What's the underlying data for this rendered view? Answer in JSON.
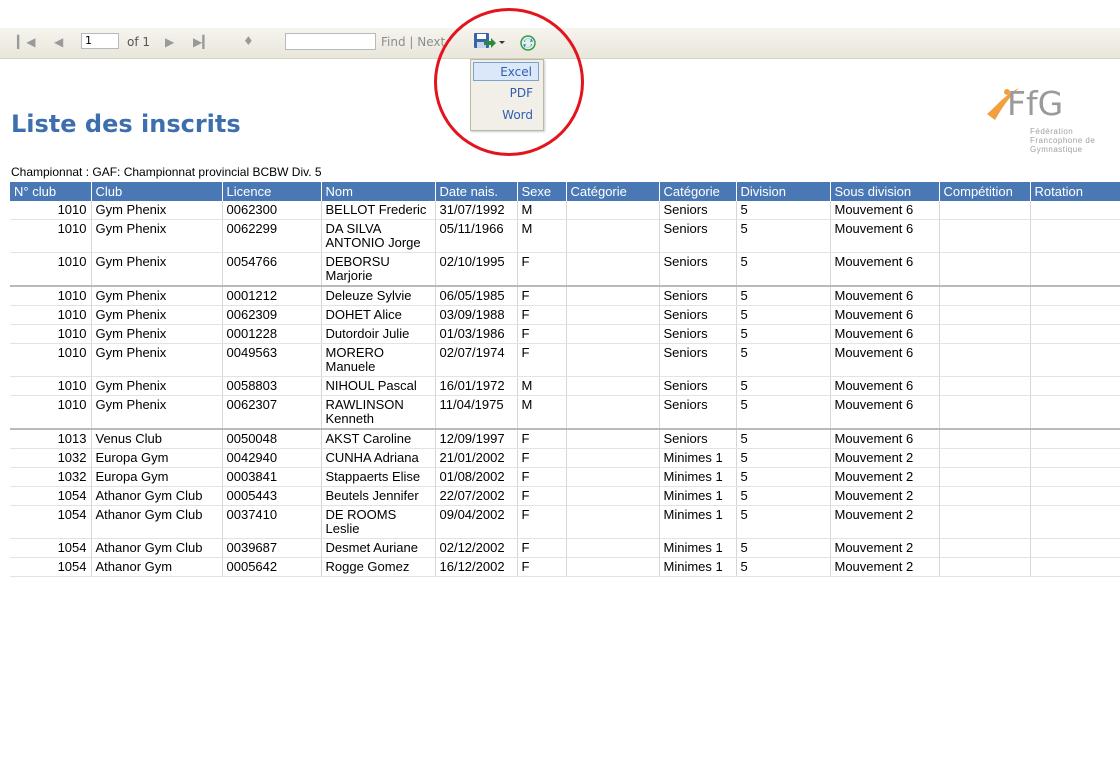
{
  "toolbar": {
    "page_current": "1",
    "page_of": "of 1",
    "find_label": "Find | Next"
  },
  "export_menu": {
    "items": [
      {
        "label": "Excel",
        "selected": true
      },
      {
        "label": "PDF",
        "selected": false
      },
      {
        "label": "Word",
        "selected": false
      }
    ]
  },
  "report": {
    "title": "Liste des inscrits",
    "subtitle": "Championnat : GAF: Championnat provincial BCBW Div. 5"
  },
  "logo": {
    "mark": "FfG",
    "line1": "Fédération",
    "line2": "Francophone de",
    "line3": "Gymnastique"
  },
  "table": {
    "columns": [
      "N° club",
      "Club",
      "Licence",
      "Nom",
      "Date nais.",
      "Sexe",
      "Catégorie",
      "Catégorie",
      "Division",
      "Sous division",
      "Compétition",
      "Rotation"
    ],
    "rows": [
      {
        "club_no": "1010",
        "club": "Gym Phenix",
        "licence": "0062300",
        "nom": "BELLOT Frederic",
        "date": "31/07/1992",
        "sexe": "M",
        "cat1": "",
        "cat2": "Seniors",
        "division": "5",
        "sous_division": "Mouvement 6",
        "competition": "",
        "rotation": ""
      },
      {
        "club_no": "1010",
        "club": "Gym Phenix",
        "licence": "0062299",
        "nom": "DA SILVA ANTONIO Jorge",
        "date": "05/11/1966",
        "sexe": "M",
        "cat1": "",
        "cat2": "Seniors",
        "division": "5",
        "sous_division": "Mouvement 6",
        "competition": "",
        "rotation": ""
      },
      {
        "club_no": "1010",
        "club": "Gym Phenix",
        "licence": "0054766",
        "nom": "DEBORSU Marjorie",
        "date": "02/10/1995",
        "sexe": "F",
        "cat1": "",
        "cat2": "Seniors",
        "division": "5",
        "sous_division": "Mouvement 6",
        "competition": "",
        "rotation": ""
      },
      {
        "club_no": "1010",
        "club": "Gym Phenix",
        "licence": "0001212",
        "nom": "Deleuze Sylvie",
        "date": "06/05/1985",
        "sexe": "F",
        "cat1": "",
        "cat2": "Seniors",
        "division": "5",
        "sous_division": "Mouvement 6",
        "competition": "",
        "rotation": ""
      },
      {
        "club_no": "1010",
        "club": "Gym Phenix",
        "licence": "0062309",
        "nom": "DOHET Alice",
        "date": "03/09/1988",
        "sexe": "F",
        "cat1": "",
        "cat2": "Seniors",
        "division": "5",
        "sous_division": "Mouvement 6",
        "competition": "",
        "rotation": ""
      },
      {
        "club_no": "1010",
        "club": "Gym Phenix",
        "licence": "0001228",
        "nom": "Dutordoir Julie",
        "date": "01/03/1986",
        "sexe": "F",
        "cat1": "",
        "cat2": "Seniors",
        "division": "5",
        "sous_division": "Mouvement 6",
        "competition": "",
        "rotation": ""
      },
      {
        "club_no": "1010",
        "club": "Gym Phenix",
        "licence": "0049563",
        "nom": "MORERO Manuele",
        "date": "02/07/1974",
        "sexe": "F",
        "cat1": "",
        "cat2": "Seniors",
        "division": "5",
        "sous_division": "Mouvement 6",
        "competition": "",
        "rotation": ""
      },
      {
        "club_no": "1010",
        "club": "Gym Phenix",
        "licence": "0058803",
        "nom": "NIHOUL Pascal",
        "date": "16/01/1972",
        "sexe": "M",
        "cat1": "",
        "cat2": "Seniors",
        "division": "5",
        "sous_division": "Mouvement 6",
        "competition": "",
        "rotation": ""
      },
      {
        "club_no": "1010",
        "club": "Gym Phenix",
        "licence": "0062307",
        "nom": "RAWLINSON Kenneth",
        "date": "11/04/1975",
        "sexe": "M",
        "cat1": "",
        "cat2": "Seniors",
        "division": "5",
        "sous_division": "Mouvement 6",
        "competition": "",
        "rotation": ""
      },
      {
        "club_no": "1013",
        "club": "Venus Club",
        "licence": "0050048",
        "nom": "AKST Caroline",
        "date": "12/09/1997",
        "sexe": "F",
        "cat1": "",
        "cat2": "Seniors",
        "division": "5",
        "sous_division": "Mouvement 6",
        "competition": "",
        "rotation": ""
      },
      {
        "club_no": "1032",
        "club": "Europa Gym",
        "licence": "0042940",
        "nom": "CUNHA Adriana",
        "date": "21/01/2002",
        "sexe": "F",
        "cat1": "",
        "cat2": "Minimes 1",
        "division": "5",
        "sous_division": "Mouvement 2",
        "competition": "",
        "rotation": ""
      },
      {
        "club_no": "1032",
        "club": "Europa Gym",
        "licence": "0003841",
        "nom": "Stappaerts Elise",
        "date": "01/08/2002",
        "sexe": "F",
        "cat1": "",
        "cat2": "Minimes 1",
        "division": "5",
        "sous_division": "Mouvement 2",
        "competition": "",
        "rotation": ""
      },
      {
        "club_no": "1054",
        "club": "Athanor Gym Club",
        "licence": "0005443",
        "nom": "Beutels Jennifer",
        "date": "22/07/2002",
        "sexe": "F",
        "cat1": "",
        "cat2": "Minimes 1",
        "division": "5",
        "sous_division": "Mouvement 2",
        "competition": "",
        "rotation": ""
      },
      {
        "club_no": "1054",
        "club": "Athanor Gym Club",
        "licence": "0037410",
        "nom": "DE ROOMS Leslie",
        "date": "09/04/2002",
        "sexe": "F",
        "cat1": "",
        "cat2": "Minimes 1",
        "division": "5",
        "sous_division": "Mouvement 2",
        "competition": "",
        "rotation": ""
      },
      {
        "club_no": "1054",
        "club": "Athanor Gym Club",
        "licence": "0039687",
        "nom": "Desmet Auriane",
        "date": "02/12/2002",
        "sexe": "F",
        "cat1": "",
        "cat2": "Minimes 1",
        "division": "5",
        "sous_division": "Mouvement 2",
        "competition": "",
        "rotation": ""
      },
      {
        "club_no": "1054",
        "club": "Athanor Gym",
        "licence": "0005642",
        "nom": "Rogge Gomez",
        "date": "16/12/2002",
        "sexe": "F",
        "cat1": "",
        "cat2": "Minimes 1",
        "division": "5",
        "sous_division": "Mouvement 2",
        "competition": "",
        "rotation": ""
      }
    ]
  }
}
